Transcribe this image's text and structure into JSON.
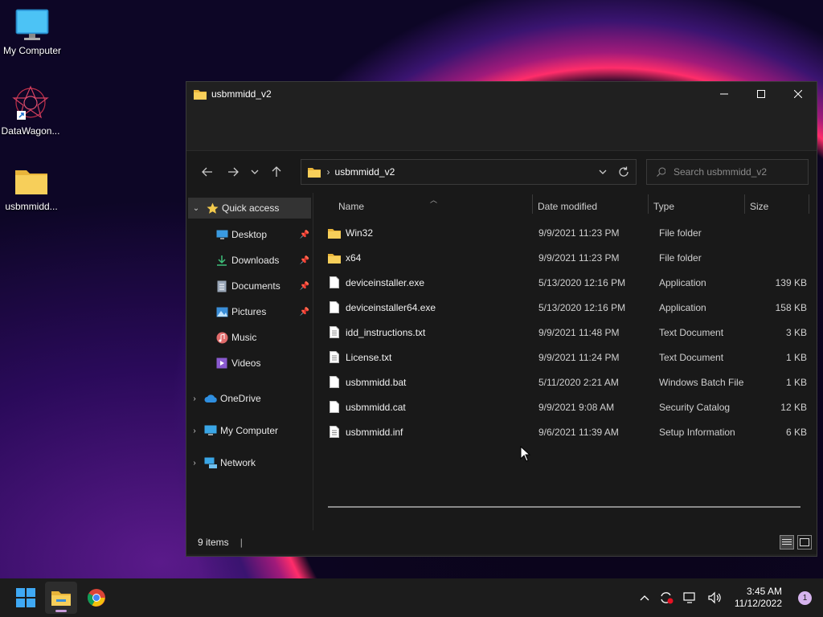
{
  "desktop": {
    "icons": [
      {
        "label": "My Computer"
      },
      {
        "label": "DataWagon..."
      },
      {
        "label": "usbmmidd..."
      }
    ]
  },
  "window": {
    "title": "usbmmidd_v2",
    "address": {
      "crumb": "usbmmidd_v2"
    },
    "search": {
      "placeholder": "Search usbmmidd_v2"
    },
    "sidebar": {
      "quick_access": "Quick access",
      "items": [
        {
          "label": "Desktop"
        },
        {
          "label": "Downloads"
        },
        {
          "label": "Documents"
        },
        {
          "label": "Pictures"
        },
        {
          "label": "Music"
        },
        {
          "label": "Videos"
        }
      ],
      "onedrive": "OneDrive",
      "my_computer": "My Computer",
      "network": "Network"
    },
    "columns": {
      "name": "Name",
      "date": "Date modified",
      "type": "Type",
      "size": "Size"
    },
    "files": [
      {
        "name": "Win32",
        "date": "9/9/2021 11:23 PM",
        "type": "File folder",
        "size": "",
        "icon": "folder-icon"
      },
      {
        "name": "x64",
        "date": "9/9/2021 11:23 PM",
        "type": "File folder",
        "size": "",
        "icon": "folder-icon"
      },
      {
        "name": "deviceinstaller.exe",
        "date": "5/13/2020 12:16 PM",
        "type": "Application",
        "size": "139 KB",
        "icon": "file-icon"
      },
      {
        "name": "deviceinstaller64.exe",
        "date": "5/13/2020 12:16 PM",
        "type": "Application",
        "size": "158 KB",
        "icon": "file-icon"
      },
      {
        "name": "idd_instructions.txt",
        "date": "9/9/2021 11:48 PM",
        "type": "Text Document",
        "size": "3 KB",
        "icon": "text-file-icon"
      },
      {
        "name": "License.txt",
        "date": "9/9/2021 11:24 PM",
        "type": "Text Document",
        "size": "1 KB",
        "icon": "text-file-icon"
      },
      {
        "name": "usbmmidd.bat",
        "date": "5/11/2020 2:21 AM",
        "type": "Windows Batch File",
        "size": "1 KB",
        "icon": "file-icon"
      },
      {
        "name": "usbmmidd.cat",
        "date": "9/9/2021 9:08 AM",
        "type": "Security Catalog",
        "size": "12 KB",
        "icon": "file-icon"
      },
      {
        "name": "usbmmidd.inf",
        "date": "9/6/2021 11:39 AM",
        "type": "Setup Information",
        "size": "6 KB",
        "icon": "text-file-icon"
      }
    ],
    "status": {
      "item_count": "9 items"
    }
  },
  "taskbar": {
    "time": "3:45 AM",
    "date": "11/12/2022",
    "notification_count": "1"
  },
  "colors": {
    "folder": "#f2c94c",
    "accent": "#0078d4"
  }
}
